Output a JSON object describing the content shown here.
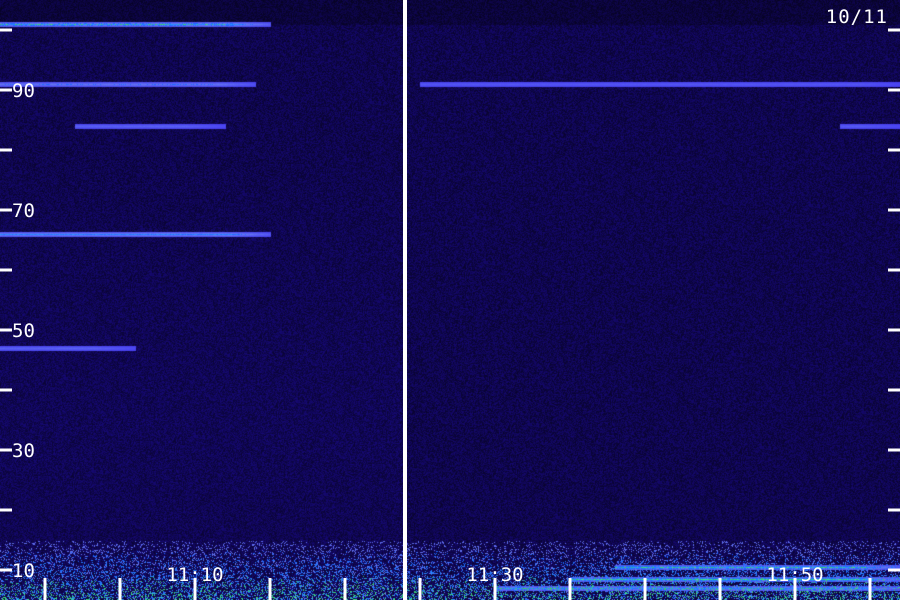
{
  "chart_data": {
    "type": "heatmap",
    "date": "10/11",
    "title": "",
    "xlabel": "",
    "ylabel": "",
    "y_ticks": [
      10,
      20,
      30,
      40,
      50,
      60,
      70,
      80,
      90,
      100
    ],
    "y_tick_labels": [
      "10",
      "",
      "30",
      "",
      "50",
      "",
      "70",
      "",
      "90",
      ""
    ],
    "ylim": [
      5,
      105
    ],
    "x_tick_labels": [
      "11:10",
      "11:30",
      "11:50"
    ],
    "x_ticks_minutes": [
      10,
      30,
      50
    ],
    "xlim_minutes": [
      -3,
      57
    ],
    "gap_minutes": 24,
    "colors": {
      "background": "#1a0a5a",
      "low": "#2a10a0",
      "mid": "#3f3ff0",
      "high": "#40e0ff",
      "peak": "#40ff80",
      "divider": "#ffffff"
    },
    "bands": [
      {
        "freq": 101,
        "minute_from": -3,
        "minute_to": 15,
        "level": 0.85
      },
      {
        "freq": 91,
        "minute_from": -3,
        "minute_to": 14,
        "level": 0.55
      },
      {
        "freq": 91,
        "minute_from": 25,
        "minute_to": 57,
        "level": 0.25
      },
      {
        "freq": 84,
        "minute_from": 2,
        "minute_to": 12,
        "level": 0.35
      },
      {
        "freq": 84,
        "minute_from": 53,
        "minute_to": 57,
        "level": 0.3
      },
      {
        "freq": 66,
        "minute_from": -3,
        "minute_to": 15,
        "level": 0.75
      },
      {
        "freq": 47,
        "minute_from": -3,
        "minute_to": 6,
        "level": 0.35
      },
      {
        "freq": 10.5,
        "minute_from": 38,
        "minute_to": 57,
        "level": 0.9
      },
      {
        "freq": 8.5,
        "minute_from": 35,
        "minute_to": 57,
        "level": 0.95
      },
      {
        "freq": 7,
        "minute_from": 30,
        "minute_to": 57,
        "level": 0.8
      }
    ]
  }
}
